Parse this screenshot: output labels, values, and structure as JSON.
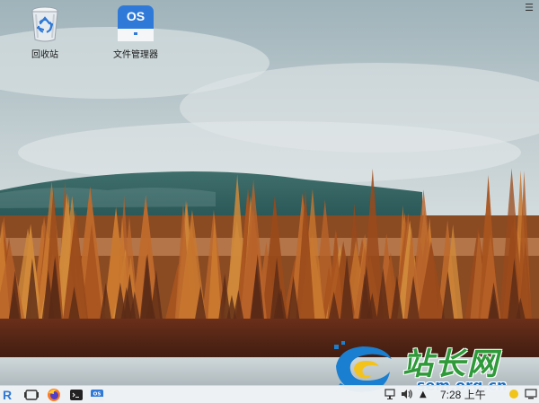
{
  "desktop": {
    "icons": [
      {
        "label": "回收站",
        "icon": "recycle-bin-icon"
      },
      {
        "label": "文件管理器",
        "icon": "file-manager-icon",
        "badge": "OS"
      }
    ]
  },
  "taskbar": {
    "launcher": "R",
    "apps": [
      "launcher-icon",
      "multitask-view-icon",
      "firefox-icon",
      "terminal-icon",
      "file-manager-icon"
    ],
    "clock": "7:28 上午",
    "tray": [
      "network-icon",
      "volume-icon",
      "expand-tray-icon",
      "notification-icon",
      "desktop-icon"
    ]
  },
  "watermark": {
    "brand": "站长网",
    "url": "sem.org.cn"
  },
  "colors": {
    "taskbar_bg": "#eef2f6",
    "accent": "#2f78d6",
    "foliage": "#b8632a",
    "sky": "#c9d4d8"
  }
}
